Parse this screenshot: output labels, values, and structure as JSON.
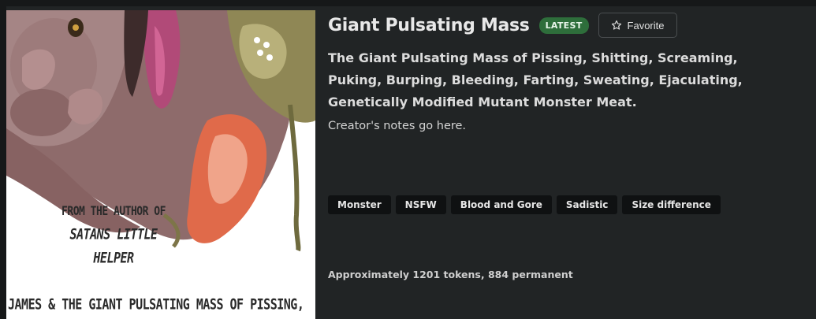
{
  "card": {
    "title": "Giant Pulsating Mass",
    "badge": "LATEST",
    "favorite_label": "Favorite",
    "tagline": "The Giant Pulsating Mass of Pissing, Shitting, Screaming, Puking, Burping, Bleeding, Farting, Sweating, Ejaculating, Genetically Modified Mutant Monster Meat.",
    "notes": "Creator's notes go here.",
    "tags": [
      "Monster",
      "NSFW",
      "Blood and Gore",
      "Sadistic",
      "Size difference"
    ],
    "tokens": "Approximately 1201 tokens, 884 permanent"
  },
  "cover": {
    "line1": "FROM THE AUTHOR OF",
    "line2": "SATANS LITTLE",
    "line3": "HELPER",
    "line4": "JAMES & THE GIANT PULSATING MASS OF PISSING,"
  },
  "colors": {
    "background": "#161819",
    "card": "#212425",
    "badge": "#2e6e3b",
    "tag": "#0f1112"
  }
}
